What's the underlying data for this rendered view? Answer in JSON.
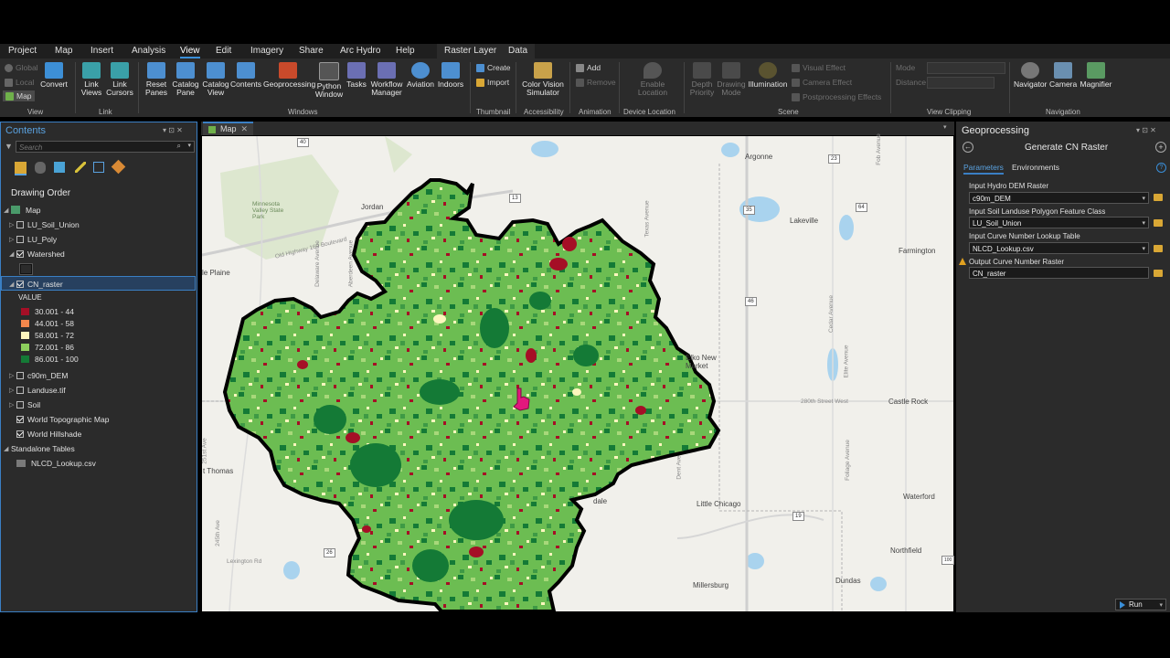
{
  "menu": {
    "items": [
      "Project",
      "Map",
      "Insert",
      "Analysis",
      "View",
      "Edit",
      "Imagery",
      "Share",
      "Arc Hydro",
      "Help"
    ],
    "active": "View",
    "context_tabs": [
      "Raster Layer",
      "Data"
    ]
  },
  "ribbon": {
    "view_group": {
      "global": "Global",
      "local": "Local",
      "map": "Map",
      "convert": "Convert",
      "label": "View"
    },
    "link_group": {
      "link_views": "Link\nViews",
      "link_cursors": "Link\nCursors",
      "label": "Link"
    },
    "windows_group": {
      "reset_panes": "Reset\nPanes",
      "catalog_pane": "Catalog\nPane",
      "catalog_view": "Catalog\nView",
      "contents": "Contents",
      "geoprocessing": "Geoprocessing",
      "python_window": "Python\nWindow",
      "tasks": "Tasks",
      "workflow_manager": "Workflow\nManager",
      "aviation": "Aviation",
      "indoors": "Indoors",
      "label": "Windows"
    },
    "thumbnail_group": {
      "create": "Create",
      "import": "Import",
      "label": "Thumbnail"
    },
    "accessibility_group": {
      "color_vision": "Color Vision\nSimulator",
      "label": "Accessibility"
    },
    "animation_group": {
      "add": "Add",
      "remove": "Remove",
      "label": "Animation"
    },
    "device_group": {
      "enable_location": "Enable\nLocation",
      "label": "Device Location"
    },
    "scene_group": {
      "depth_priority": "Depth\nPriority",
      "drawing_mode": "Drawing\nMode",
      "illumination": "Illumination",
      "visual_effect": "Visual Effect",
      "camera_effect": "Camera Effect",
      "postprocessing": "Postprocessing Effects",
      "label": "Scene"
    },
    "clipping_group": {
      "mode": "Mode",
      "distance": "Distance",
      "label": "View Clipping"
    },
    "navigation_group": {
      "navigator": "Navigator",
      "camera": "Camera",
      "magnifier": "Magnifier",
      "label": "Navigation"
    }
  },
  "contents": {
    "title": "Contents",
    "search_placeholder": "Search",
    "drawing_order": "Drawing Order",
    "map": "Map",
    "layers": [
      {
        "name": "LU_Soil_Union",
        "checked": false
      },
      {
        "name": "LU_Poly",
        "checked": false
      },
      {
        "name": "Watershed",
        "checked": true
      },
      {
        "name": "CN_raster",
        "checked": true
      },
      {
        "name": "c90m_DEM",
        "checked": false
      },
      {
        "name": "Landuse.tif",
        "checked": false
      },
      {
        "name": "Soil",
        "checked": false
      },
      {
        "name": "World Topographic Map",
        "checked": true
      },
      {
        "name": "World Hillshade",
        "checked": true
      }
    ],
    "value_label": "VALUE",
    "legend": [
      {
        "label": "30.001 - 44",
        "color": "#a50f26"
      },
      {
        "label": "44.001 - 58",
        "color": "#f4874c"
      },
      {
        "label": "58.001 - 72",
        "color": "#fdf6be"
      },
      {
        "label": "72.001 - 86",
        "color": "#8ccf5d"
      },
      {
        "label": "86.001 - 100",
        "color": "#147a36"
      }
    ],
    "standalone_tables": "Standalone Tables",
    "table": "NLCD_Lookup.csv"
  },
  "map_view": {
    "tab": "Map",
    "labels": {
      "argonne": "Argonne",
      "lakeville": "Lakeville",
      "farmington": "Farmington",
      "jordan": "Jordan",
      "minnesota_valley": "Minnesota\nValley State\nPark",
      "elko": "Elko New\nMarket",
      "castle_rock": "Castle Rock",
      "little_chicago": "Little Chicago",
      "waterford": "Waterford",
      "northfield": "Northfield",
      "dundas": "Dundas",
      "millersburg": "Millersburg",
      "plaine": "le Plaine",
      "st_thomas": "t Thomas",
      "lexington": "Lexington Rd",
      "street_280": "280th Street West",
      "cedar": "Cedar Avenue",
      "foliage": "Foliage Avenue",
      "dale": "dale",
      "old_hwy": "Old Highway 169 Boulevard",
      "aberdeen": "Aberdeen Avenue",
      "delaware": "Delaware Avenue",
      "ave_251": "251st Ave",
      "ave_245": "245th Ave",
      "dent": "Dent Ave",
      "texas": "Texas Avenue",
      "fob": "Fob Avenue",
      "elite": "Elite Avenue"
    },
    "shields": [
      "40",
      "23",
      "13",
      "35",
      "64",
      "46",
      "19",
      "26",
      "100"
    ]
  },
  "geoprocessing": {
    "title": "Geoprocessing",
    "tool": "Generate CN Raster",
    "tabs": [
      "Parameters",
      "Environments"
    ],
    "params": [
      {
        "label": "Input Hydro DEM Raster",
        "value": "c90m_DEM"
      },
      {
        "label": "Input Soil Landuse Polygon Feature Class",
        "value": "LU_Soil_Union"
      },
      {
        "label": "Input Curve Number Lookup Table",
        "value": "NLCD_Lookup.csv"
      },
      {
        "label": "Output Curve Number Raster",
        "value": "CN_raster"
      }
    ],
    "run": "Run"
  }
}
